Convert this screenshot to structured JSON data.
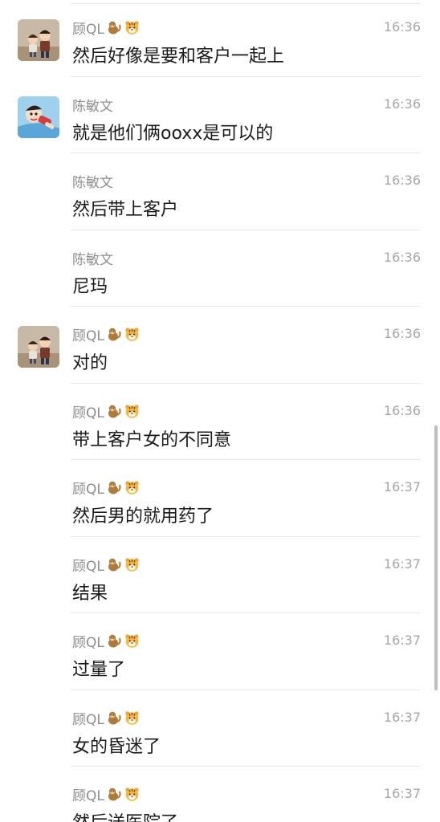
{
  "messages": [
    {
      "sender": "顾QL",
      "avatar": "gu",
      "emojis": [
        "monkey",
        "tiger"
      ],
      "time": "16:36",
      "text": "然后好像是要和客户一起上"
    },
    {
      "sender": "陈敏文",
      "avatar": "chen",
      "emojis": [],
      "time": "16:36",
      "text": "就是他们俩ooxx是可以的"
    },
    {
      "sender": "陈敏文",
      "avatar": "",
      "emojis": [],
      "time": "16:36",
      "text": "然后带上客户"
    },
    {
      "sender": "陈敏文",
      "avatar": "",
      "emojis": [],
      "time": "16:36",
      "text": "尼玛"
    },
    {
      "sender": "顾QL",
      "avatar": "gu",
      "emojis": [
        "monkey",
        "tiger"
      ],
      "time": "16:36",
      "text": "对的"
    },
    {
      "sender": "顾QL",
      "avatar": "",
      "emojis": [
        "monkey",
        "tiger"
      ],
      "time": "16:36",
      "text": "带上客户女的不同意"
    },
    {
      "sender": "顾QL",
      "avatar": "",
      "emojis": [
        "monkey",
        "tiger"
      ],
      "time": "16:37",
      "text": "然后男的就用药了"
    },
    {
      "sender": "顾QL",
      "avatar": "",
      "emojis": [
        "monkey",
        "tiger"
      ],
      "time": "16:37",
      "text": "结果"
    },
    {
      "sender": "顾QL",
      "avatar": "",
      "emojis": [
        "monkey",
        "tiger"
      ],
      "time": "16:37",
      "text": "过量了"
    },
    {
      "sender": "顾QL",
      "avatar": "",
      "emojis": [
        "monkey",
        "tiger"
      ],
      "time": "16:37",
      "text": "女的昏迷了"
    },
    {
      "sender": "顾QL",
      "avatar": "",
      "emojis": [
        "monkey",
        "tiger"
      ],
      "time": "16:37",
      "text": "然后送医院了"
    }
  ]
}
